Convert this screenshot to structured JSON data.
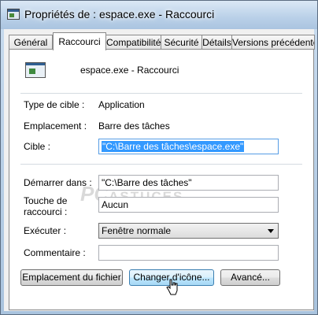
{
  "window": {
    "title": "Propriétés de : espace.exe - Raccourci"
  },
  "tabs": [
    {
      "label": "Général"
    },
    {
      "label": "Raccourci"
    },
    {
      "label": "Compatibilité"
    },
    {
      "label": "Sécurité"
    },
    {
      "label": "Détails"
    },
    {
      "label": "Versions précédentes"
    }
  ],
  "shortcut": {
    "name": "espace.exe - Raccourci",
    "icon": "application-window-icon"
  },
  "fields": {
    "target_type_label": "Type de cible :",
    "target_type_value": "Application",
    "location_label": "Emplacement :",
    "location_value": "Barre des tâches",
    "target_label": "Cible :",
    "target_value": "\"C:\\Barre des tâches\\espace.exe\"",
    "start_in_label": "Démarrer dans :",
    "start_in_value": "\"C:\\Barre des tâches\"",
    "hotkey_label_line1": "Touche de",
    "hotkey_label_line2": "raccourci :",
    "hotkey_value": "Aucun",
    "run_label": "Exécuter :",
    "run_value": "Fenêtre normale",
    "comment_label": "Commentaire :",
    "comment_value": ""
  },
  "buttons": {
    "open_location": "Emplacement du fichier",
    "change_icon": "Changer d'icône...",
    "advanced": "Avancé..."
  },
  "watermark": {
    "pc": "PC",
    "rest": "ASTUCES"
  },
  "colors": {
    "selection": "#3399ff",
    "focus_border": "#569de5",
    "hover_button": "#bee6fd"
  }
}
